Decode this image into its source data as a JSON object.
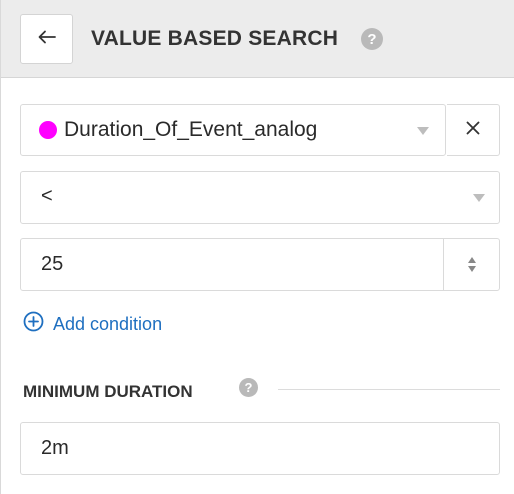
{
  "header": {
    "title": "VALUE BASED SEARCH",
    "back_icon": "arrow-left-icon",
    "help_icon": "question-circle-icon",
    "help_glyph": "?"
  },
  "condition": {
    "variable": {
      "name": "Duration_Of_Event_analog",
      "color": "#ff00ff"
    },
    "operator": "<",
    "value": "25"
  },
  "add_condition": {
    "label": "Add condition",
    "icon": "plus-circle-icon"
  },
  "minimum_duration": {
    "label": "MINIMUM DURATION",
    "help_glyph": "?",
    "value": "2m"
  },
  "colors": {
    "accent": "#1e6fc0",
    "header_bg": "#ececec"
  }
}
